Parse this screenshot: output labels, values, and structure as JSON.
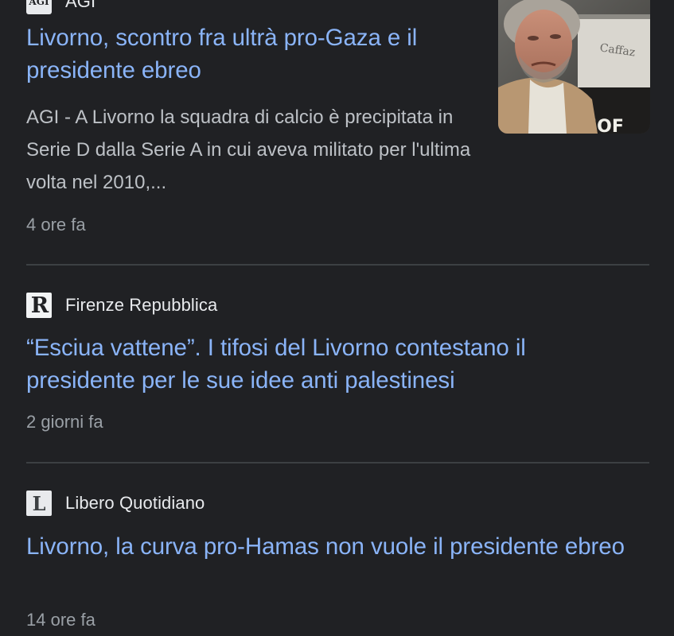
{
  "articles": [
    {
      "source": "AGI",
      "logo_text": "AGI",
      "headline": "Livorno, scontro fra ultrà pro-Gaza e il presidente ebreo",
      "snippet": "AGI - A Livorno la squadra di calcio è precipitata in Serie D dalla Serie A in cui aveva militato per l'ultima volta nel 2010,...",
      "time": "4 ore fa",
      "thumbnail_text": "Caffaz",
      "thumbnail_sign": "JOF"
    },
    {
      "source": "Firenze Repubblica",
      "logo_text": "R",
      "headline": "“Esciua vattene”. I tifosi del Livorno contestano il presidente per le sue idee anti palestinesi",
      "time": "2 giorni fa"
    },
    {
      "source": "Libero Quotidiano",
      "logo_text": "L",
      "headline": "Livorno, la curva pro-Hamas non vuole il presidente ebreo",
      "time": "14 ore fa"
    }
  ],
  "colors": {
    "background": "#202124",
    "headline": "#8ab4f8",
    "snippet": "#bdc1c6",
    "source": "#e8eaed",
    "time": "#9aa0a6",
    "divider": "#3c4043"
  }
}
